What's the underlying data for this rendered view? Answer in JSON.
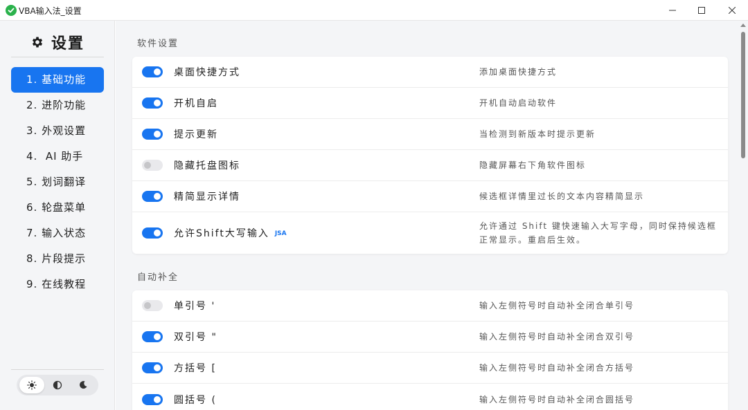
{
  "window": {
    "title": "VBA输入法_设置"
  },
  "sidebar": {
    "title": "设置",
    "items": [
      {
        "label": "1. 基础功能",
        "active": true
      },
      {
        "label": "2. 进阶功能",
        "active": false
      },
      {
        "label": "3. 外观设置",
        "active": false
      },
      {
        "label": "4.  AI 助手",
        "active": false
      },
      {
        "label": "5. 划词翻译",
        "active": false
      },
      {
        "label": "6. 轮盘菜单",
        "active": false
      },
      {
        "label": "7. 输入状态",
        "active": false
      },
      {
        "label": "8. 片段提示",
        "active": false
      },
      {
        "label": "9. 在线教程",
        "active": false
      }
    ],
    "theme_options": [
      "light-mode-icon",
      "auto-mode-icon",
      "dark-mode-icon"
    ],
    "theme_selected": "light"
  },
  "sections": [
    {
      "title": "软件设置",
      "rows": [
        {
          "label": "桌面快捷方式",
          "desc": "添加桌面快捷方式",
          "enabled": true
        },
        {
          "label": "开机自启",
          "desc": "开机自动启动软件",
          "enabled": true
        },
        {
          "label": "提示更新",
          "desc": "当检测到新版本时提示更新",
          "enabled": true
        },
        {
          "label": "隐藏托盘图标",
          "desc": "隐藏屏幕右下角软件图标",
          "enabled": false
        },
        {
          "label": "精简显示详情",
          "desc": "候选框详情里过长的文本内容精简显示",
          "enabled": true
        },
        {
          "label": "允许Shift大写输入",
          "badge": "JSA",
          "desc": "允许通过 Shift 键快速输入大写字母，同时保持候选框正常显示。重启后生效。",
          "enabled": true
        }
      ]
    },
    {
      "title": "自动补全",
      "rows": [
        {
          "label": "单引号 '",
          "desc": "输入左侧符号时自动补全闭合单引号",
          "enabled": false
        },
        {
          "label": "双引号 \"",
          "desc": "输入左侧符号时自动补全闭合双引号",
          "enabled": true
        },
        {
          "label": "方括号 [",
          "desc": "输入左侧符号时自动补全闭合方括号",
          "enabled": true
        },
        {
          "label": "圆括号 (",
          "desc": "输入左侧符号时自动补全闭合圆括号",
          "enabled": true
        }
      ]
    }
  ],
  "colors": {
    "accent": "#1875f0",
    "sidebar_bg": "#f4f5f7",
    "app_icon": "#2bb24c"
  }
}
